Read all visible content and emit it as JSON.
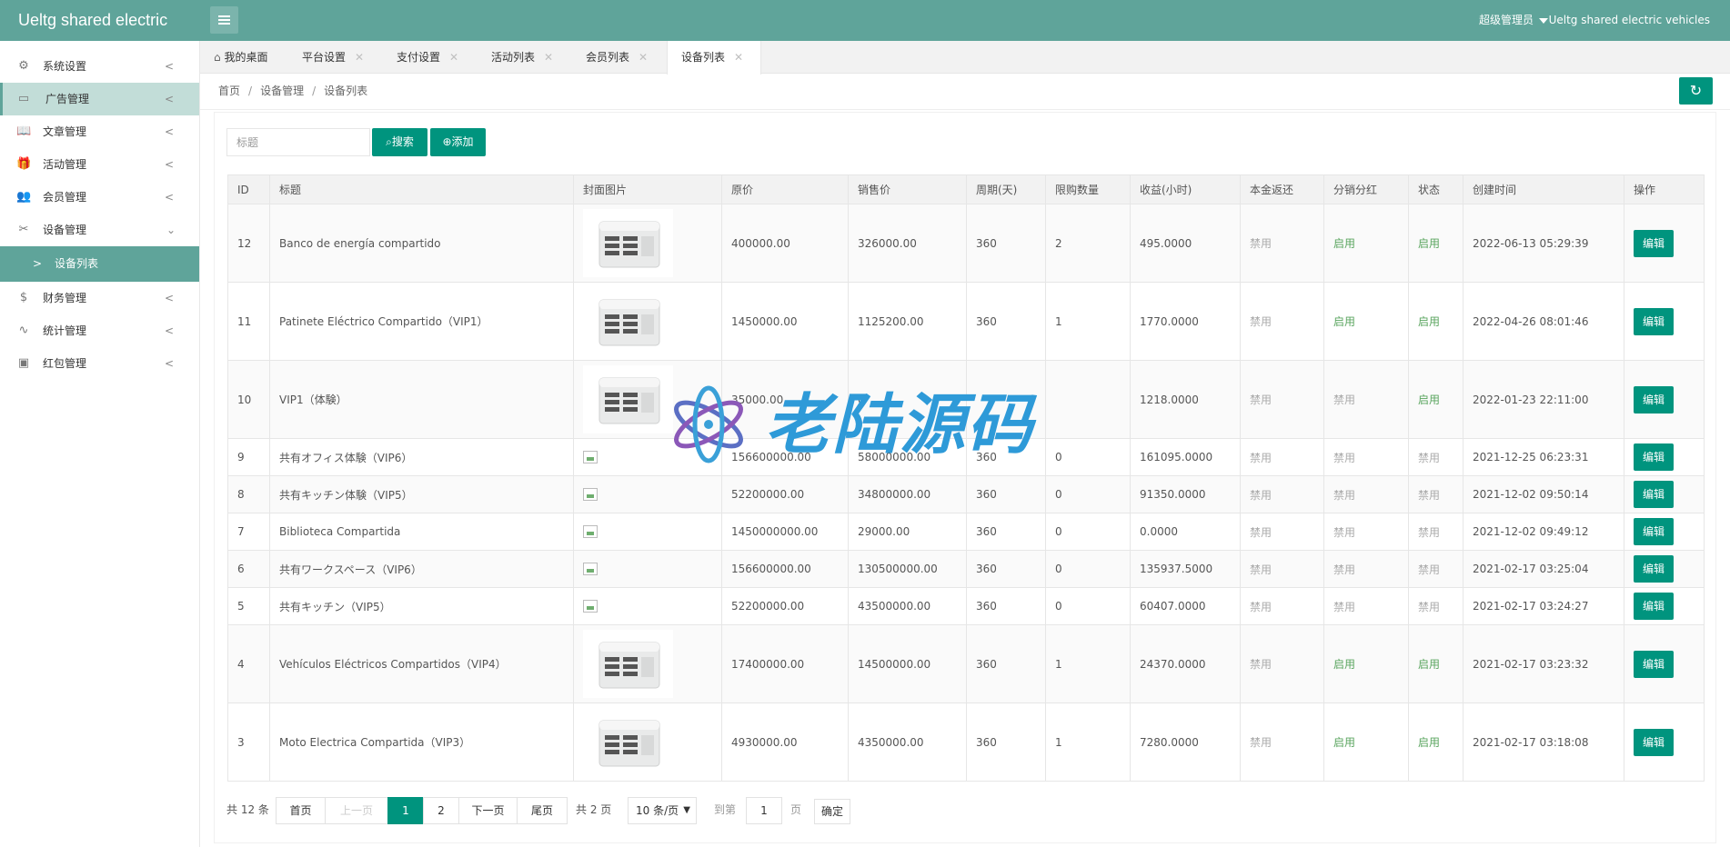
{
  "app": {
    "logo": "Ueltg shared electric",
    "admin_name": "超级管理员",
    "brand_right": "Ueltg shared electric vehicles"
  },
  "sidebar": {
    "items": [
      {
        "label": "系统设置",
        "icon": "gear-icon"
      },
      {
        "label": "广告管理",
        "icon": "image-icon"
      },
      {
        "label": "文章管理",
        "icon": "book-icon"
      },
      {
        "label": "活动管理",
        "icon": "gift-icon"
      },
      {
        "label": "会员管理",
        "icon": "users-icon"
      },
      {
        "label": "设备管理",
        "icon": "tools-icon"
      },
      {
        "label": "财务管理",
        "icon": "dollar-icon"
      },
      {
        "label": "统计管理",
        "icon": "pulse-icon"
      },
      {
        "label": "红包管理",
        "icon": "redpacket-icon"
      }
    ],
    "subitem": "设备列表"
  },
  "tabs": [
    {
      "label": "我的桌面"
    },
    {
      "label": "平台设置"
    },
    {
      "label": "支付设置"
    },
    {
      "label": "活动列表"
    },
    {
      "label": "会员列表"
    },
    {
      "label": "设备列表"
    }
  ],
  "breadcrumb": [
    "首页",
    "设备管理",
    "设备列表"
  ],
  "toolbar": {
    "search_placeholder": "标题",
    "search_label": "搜索",
    "add_label": "添加"
  },
  "table": {
    "headers": [
      "ID",
      "标题",
      "封面图片",
      "原价",
      "销售价",
      "周期(天)",
      "限购数量",
      "收益(小时)",
      "本金返还",
      "分销分红",
      "状态",
      "创建时间",
      "操作"
    ],
    "edit_label": "编辑",
    "rows": [
      {
        "id": "12",
        "title": "Banco de energía compartido",
        "image": "thumb",
        "orig": "400000.00",
        "sale": "326000.00",
        "cycle": "360",
        "limit": "2",
        "profit": "495.0000",
        "refund": "禁用",
        "dist": "启用",
        "status": "启用",
        "created": "2022-06-13 05:29:39"
      },
      {
        "id": "11",
        "title": "Patinete Eléctrico Compartido（VIP1）",
        "image": "thumb",
        "orig": "1450000.00",
        "sale": "1125200.00",
        "cycle": "360",
        "limit": "1",
        "profit": "1770.0000",
        "refund": "禁用",
        "dist": "启用",
        "status": "启用",
        "created": "2022-04-26 08:01:46"
      },
      {
        "id": "10",
        "title": "VIP1（体験）",
        "image": "thumb",
        "orig": "35000.00",
        "sale": "0",
        "cycle": "",
        "limit": "",
        "profit": "1218.0000",
        "refund": "禁用",
        "dist": "禁用",
        "status": "启用",
        "created": "2022-01-23 22:11:00"
      },
      {
        "id": "9",
        "title": "共有オフィス体験（VIP6）",
        "image": "broken",
        "orig": "156600000.00",
        "sale": "58000000.00",
        "cycle": "360",
        "limit": "0",
        "profit": "161095.0000",
        "refund": "禁用",
        "dist": "禁用",
        "status": "禁用",
        "created": "2021-12-25 06:23:31"
      },
      {
        "id": "8",
        "title": "共有キッチン体験（VIP5）",
        "image": "broken",
        "orig": "52200000.00",
        "sale": "34800000.00",
        "cycle": "360",
        "limit": "0",
        "profit": "91350.0000",
        "refund": "禁用",
        "dist": "禁用",
        "status": "禁用",
        "created": "2021-12-02 09:50:14"
      },
      {
        "id": "7",
        "title": "Biblioteca Compartida",
        "image": "broken",
        "orig": "1450000000.00",
        "sale": "29000.00",
        "cycle": "360",
        "limit": "0",
        "profit": "0.0000",
        "refund": "禁用",
        "dist": "禁用",
        "status": "禁用",
        "created": "2021-12-02 09:49:12"
      },
      {
        "id": "6",
        "title": "共有ワークスペース（VIP6）",
        "image": "broken",
        "orig": "156600000.00",
        "sale": "130500000.00",
        "cycle": "360",
        "limit": "0",
        "profit": "135937.5000",
        "refund": "禁用",
        "dist": "禁用",
        "status": "禁用",
        "created": "2021-02-17 03:25:04"
      },
      {
        "id": "5",
        "title": "共有キッチン（VIP5）",
        "image": "broken",
        "orig": "52200000.00",
        "sale": "43500000.00",
        "cycle": "360",
        "limit": "0",
        "profit": "60407.0000",
        "refund": "禁用",
        "dist": "禁用",
        "status": "禁用",
        "created": "2021-02-17 03:24:27"
      },
      {
        "id": "4",
        "title": "Vehículos Eléctricos Compartidos（VIP4）",
        "image": "thumb",
        "orig": "17400000.00",
        "sale": "14500000.00",
        "cycle": "360",
        "limit": "1",
        "profit": "24370.0000",
        "refund": "禁用",
        "dist": "启用",
        "status": "启用",
        "created": "2021-02-17 03:23:32"
      },
      {
        "id": "3",
        "title": "Moto Electrica Compartida（VIP3）",
        "image": "thumb",
        "orig": "4930000.00",
        "sale": "4350000.00",
        "cycle": "360",
        "limit": "1",
        "profit": "7280.0000",
        "refund": "禁用",
        "dist": "启用",
        "status": "启用",
        "created": "2021-02-17 03:18:08"
      }
    ]
  },
  "pagination": {
    "total": "共 12 条",
    "first": "首页",
    "prev": "上一页",
    "pages": [
      "1",
      "2"
    ],
    "next": "下一页",
    "last": "尾页",
    "page_count": "共 2 页",
    "page_size": "10 条/页",
    "goto_label": "到第",
    "goto_value": "1",
    "page_unit": "页",
    "confirm": "确定"
  },
  "watermark": {
    "text": "老陆源码"
  },
  "colors": {
    "header": "#5fa49a",
    "primary": "#00947e",
    "enabled": "#5aa55f",
    "disabled": "#aaaaaa",
    "watermark": "#2e9ad8"
  }
}
